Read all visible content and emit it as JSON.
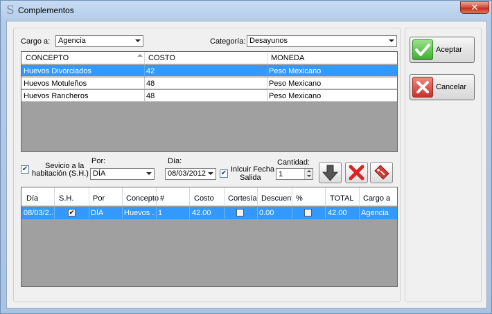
{
  "window": {
    "title": "Complementos",
    "close_glyph": "✕"
  },
  "filters": {
    "cargo_label": "Cargo a:",
    "cargo_value": "Agencia",
    "categoria_label": "Categoría:",
    "categoria_value": "Desayunos"
  },
  "catalog_grid": {
    "columns": [
      "CONCEPTO",
      "COSTO",
      "MONEDA"
    ],
    "rows": [
      {
        "concepto": "Huevos Divorciados",
        "costo": "42",
        "moneda": "Peso Mexicano",
        "selected": true
      },
      {
        "concepto": "Huevos Motuleños",
        "costo": "48",
        "moneda": "Peso Mexicano",
        "selected": false
      },
      {
        "concepto": "Huevos Rancheros",
        "costo": "48",
        "moneda": "Peso Mexicano",
        "selected": false
      }
    ]
  },
  "options": {
    "servicio_label_1": "Sevicio a la",
    "servicio_label_2": "habitación (S.H.)",
    "servicio_checked": true,
    "por_label": "Por:",
    "por_value": "DÍA",
    "dia_label": "Día:",
    "dia_value": "08/03/2012",
    "incluir_label_1": "Inlcuir Fecha",
    "incluir_label_2": "Salida",
    "incluir_checked": true,
    "cantidad_label": "Cantidad:",
    "cantidad_value": "1"
  },
  "detail_grid": {
    "columns": [
      "Día",
      "S.H.",
      "Por",
      "Concepto",
      "#",
      "Costo",
      "Cortesía",
      "Descuento",
      "%",
      "TOTAL",
      "Cargo a"
    ],
    "row": {
      "dia": "08/03/2...",
      "sh_checked": true,
      "por": "DÍA",
      "concepto": "Huevos ...",
      "num": "1",
      "costo": "42.00",
      "cortesia_checked": false,
      "descuento": "0.00",
      "pct_checked": false,
      "total": "42.00",
      "cargo": "Agencia"
    }
  },
  "actions": {
    "accept_label": "Aceptar",
    "cancel_label": "Cancelar"
  },
  "colors": {
    "selection": "#3399ff",
    "grid_background": "#a0a0a0"
  }
}
